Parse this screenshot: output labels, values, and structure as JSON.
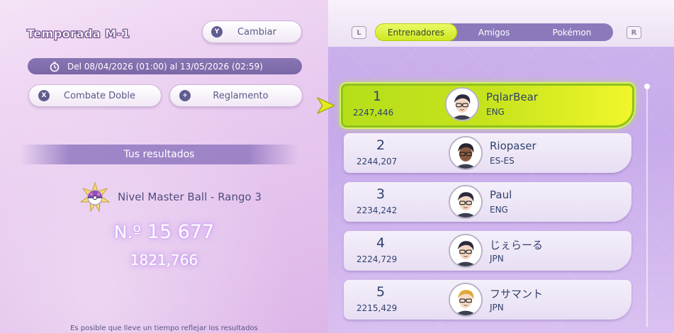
{
  "season": {
    "title": "Temporada M-1"
  },
  "change_button": {
    "glyph": "Y",
    "label": "Cambiar"
  },
  "season_period": {
    "icon": "stopwatch-icon",
    "text": "Del 08/04/2026 (01:00) al 13/05/2026 (02:59)"
  },
  "battle_format_button": {
    "glyph": "X",
    "label": "Combate Doble"
  },
  "rules_button": {
    "glyph": "+",
    "label": "Reglamento"
  },
  "my_results": {
    "heading": "Tus resultados",
    "rank_icon": "master-ball-rank-icon",
    "rank_label": "Nivel Master Ball - Rango 3",
    "position_prefix": "N.º",
    "position": "15 677",
    "score": "1821,766",
    "note": "Es posible que lleve un tiempo reflejar los resultados"
  },
  "tabs": {
    "left_shoulder": "L",
    "right_shoulder": "R",
    "items": [
      {
        "label": "Entrenadores",
        "selected": true
      },
      {
        "label": "Amigos",
        "selected": false
      },
      {
        "label": "Pokémon",
        "selected": false
      }
    ]
  },
  "leaderboard": {
    "selected_index": 0,
    "rows": [
      {
        "rank": "1",
        "points": "2247,446",
        "name": "PqlarBear",
        "region": "ENG",
        "avatar": "trainer-avatar-dark-hair-glasses"
      },
      {
        "rank": "2",
        "points": "2244,207",
        "name": "Riopaser",
        "region": "ES-ES",
        "avatar": "trainer-avatar-dark-skin-glasses"
      },
      {
        "rank": "3",
        "points": "2234,242",
        "name": "Paul",
        "region": "ENG",
        "avatar": "trainer-avatar-dark-hair-glasses"
      },
      {
        "rank": "4",
        "points": "2224,729",
        "name": "じぇらーる",
        "region": "JPN",
        "avatar": "trainer-avatar-dark-hair-glasses"
      },
      {
        "rank": "5",
        "points": "2215,429",
        "name": "フサマント",
        "region": "JPN",
        "avatar": "trainer-avatar-blonde-glasses"
      }
    ]
  },
  "colors": {
    "accent_green": "#c6e31d",
    "tab_bar": "#8b79bb",
    "text_dark": "#30416d"
  }
}
